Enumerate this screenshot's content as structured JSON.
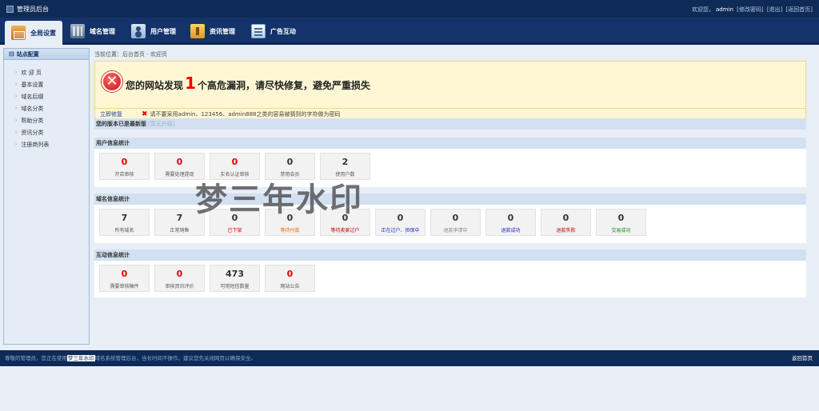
{
  "app": {
    "title": "管理员后台"
  },
  "user": {
    "greeting": "欢迎您，",
    "name": "admin",
    "change_pwd": "[修改密码]",
    "logout": "[退出]",
    "home": "[返回首页]"
  },
  "nav": [
    {
      "label": "全局设置",
      "icon": "home-icon",
      "active": true
    },
    {
      "label": "域名管理",
      "icon": "domain-icon"
    },
    {
      "label": "用户管理",
      "icon": "user-icon"
    },
    {
      "label": "资讯管理",
      "icon": "news-icon"
    },
    {
      "label": "广告互动",
      "icon": "ad-icon"
    }
  ],
  "sidebar": {
    "title": "站点配置",
    "items": [
      "欢 迎 页",
      "基本设置",
      "域名后缀",
      "域名分类",
      "帮助分类",
      "资讯分类",
      "注册商列表"
    ]
  },
  "breadcrumb": "当前位置：后台首页 - 欢迎页",
  "alert": {
    "prefix": "您的网站发现",
    "count": "1",
    "suffix": "个高危漏洞，请尽快修复，避免严重损失",
    "fix_link": "立即修复",
    "warning": "请不要采用admin、123456、admin888之类的容易被猜到的字符做为密码"
  },
  "version": {
    "text": "您的版本已是最新版",
    "upgrade": "[暂无升级]"
  },
  "user_stats": {
    "title": "用户信息统计",
    "cards": [
      {
        "value": "0",
        "label": "开店审核",
        "red": true
      },
      {
        "value": "0",
        "label": "需要处理提现",
        "red": true
      },
      {
        "value": "0",
        "label": "实名认证审核",
        "red": true
      },
      {
        "value": "0",
        "label": "禁用会员",
        "red": false
      },
      {
        "value": "2",
        "label": "使用户数",
        "red": false
      }
    ]
  },
  "domain_stats": {
    "title": "域名信息统计",
    "cards": [
      {
        "value": "7",
        "label": "所有域名",
        "color": "#555555"
      },
      {
        "value": "7",
        "label": "正常销售",
        "color": "#555555"
      },
      {
        "value": "0",
        "label": "已下架",
        "color": "#e00000"
      },
      {
        "value": "0",
        "label": "等待付款",
        "color": "#e07000"
      },
      {
        "value": "0",
        "label": "等待卖家过户",
        "color": "#c00000"
      },
      {
        "value": "0",
        "label": "正在过户、担保中",
        "color": "#1a2ad0"
      },
      {
        "value": "0",
        "label": "退款申请中",
        "color": "#888888"
      },
      {
        "value": "0",
        "label": "退款成功",
        "color": "#1a2ad0"
      },
      {
        "value": "0",
        "label": "退款失败",
        "color": "#c00000"
      },
      {
        "value": "0",
        "label": "交易成功",
        "color": "#1a8a1a"
      }
    ]
  },
  "interact_stats": {
    "title": "互动信息统计",
    "cards": [
      {
        "value": "0",
        "label": "需要审核稿件",
        "red": true
      },
      {
        "value": "0",
        "label": "审核资讯评价",
        "red": true
      },
      {
        "value": "473",
        "label": "可用短信数量",
        "red": false
      },
      {
        "value": "0",
        "label": "网站公告",
        "red": true
      }
    ]
  },
  "watermark": "梦三年水印",
  "footer": {
    "pre": "尊敬的管理员，您正在使用",
    "highlight": "梦三年水印",
    "post": "域名系统管理后台，当长时间不操作，建议您先关闭网页以确保安全。",
    "back": "返回首页"
  }
}
